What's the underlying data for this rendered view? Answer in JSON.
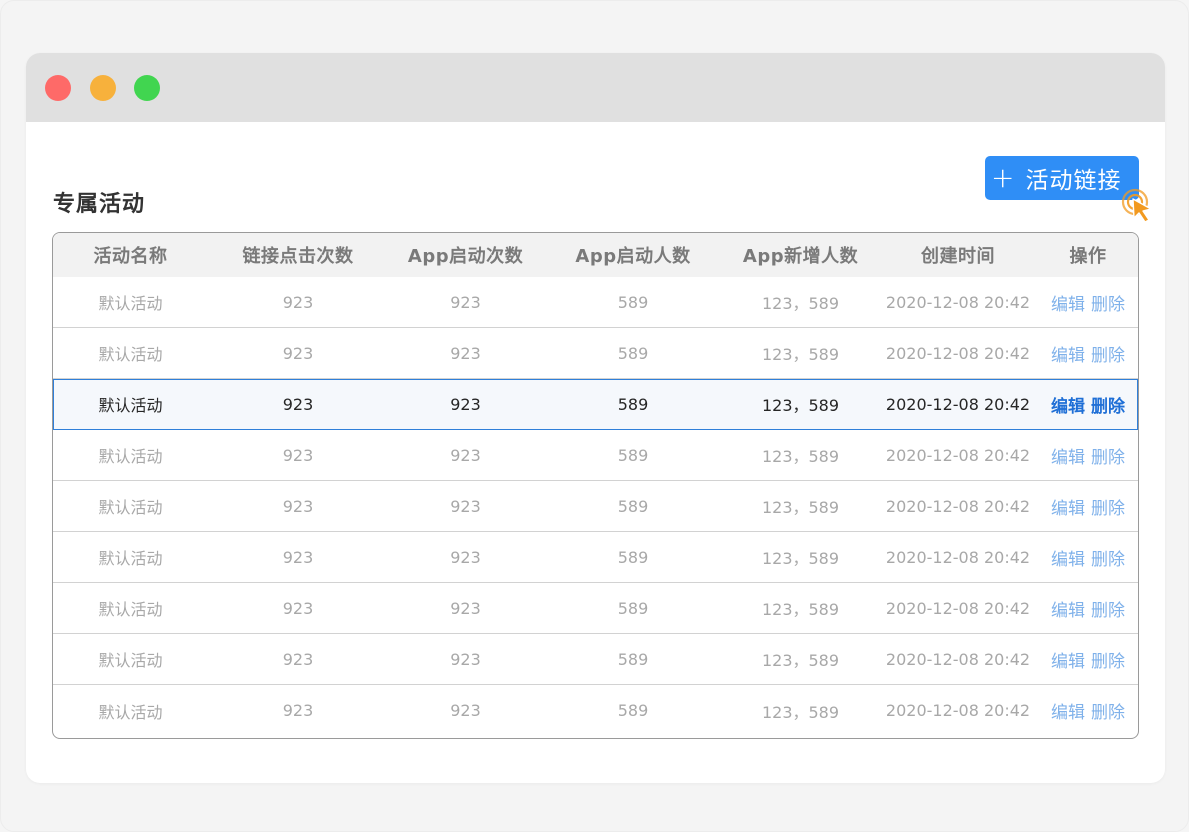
{
  "window": {
    "controls": {
      "close_color": "#fe6a68",
      "minimize_color": "#f7b13c",
      "maximize_color": "#41d550"
    }
  },
  "page": {
    "title": "专属活动",
    "add_button": {
      "icon": "plus-icon",
      "label": "活动链接",
      "color": "#2f8ef6"
    },
    "cursor": {
      "icon": "click-cursor-icon",
      "color": "#f29a20"
    }
  },
  "table": {
    "columns": [
      "活动名称",
      "链接点击次数",
      "App启动次数",
      "App启动人数",
      "App新增人数",
      "创建时间",
      "操作"
    ],
    "rows": [
      {
        "name": "默认活动",
        "clicks": "923",
        "launches": "923",
        "users": "589",
        "new_users": "123，589",
        "created": "2020-12-08 20:42",
        "edit": "编辑",
        "delete": "删除",
        "selected": false
      },
      {
        "name": "默认活动",
        "clicks": "923",
        "launches": "923",
        "users": "589",
        "new_users": "123，589",
        "created": "2020-12-08 20:42",
        "edit": "编辑",
        "delete": "删除",
        "selected": false
      },
      {
        "name": "默认活动",
        "clicks": "923",
        "launches": "923",
        "users": "589",
        "new_users": "123，589",
        "created": "2020-12-08 20:42",
        "edit": "编辑",
        "delete": "删除",
        "selected": true
      },
      {
        "name": "默认活动",
        "clicks": "923",
        "launches": "923",
        "users": "589",
        "new_users": "123，589",
        "created": "2020-12-08 20:42",
        "edit": "编辑",
        "delete": "删除",
        "selected": false
      },
      {
        "name": "默认活动",
        "clicks": "923",
        "launches": "923",
        "users": "589",
        "new_users": "123，589",
        "created": "2020-12-08 20:42",
        "edit": "编辑",
        "delete": "删除",
        "selected": false
      },
      {
        "name": "默认活动",
        "clicks": "923",
        "launches": "923",
        "users": "589",
        "new_users": "123，589",
        "created": "2020-12-08 20:42",
        "edit": "编辑",
        "delete": "删除",
        "selected": false
      },
      {
        "name": "默认活动",
        "clicks": "923",
        "launches": "923",
        "users": "589",
        "new_users": "123，589",
        "created": "2020-12-08 20:42",
        "edit": "编辑",
        "delete": "删除",
        "selected": false
      },
      {
        "name": "默认活动",
        "clicks": "923",
        "launches": "923",
        "users": "589",
        "new_users": "123，589",
        "created": "2020-12-08 20:42",
        "edit": "编辑",
        "delete": "删除",
        "selected": false
      },
      {
        "name": "默认活动",
        "clicks": "923",
        "launches": "923",
        "users": "589",
        "new_users": "123，589",
        "created": "2020-12-08 20:42",
        "edit": "编辑",
        "delete": "删除",
        "selected": false
      }
    ]
  }
}
